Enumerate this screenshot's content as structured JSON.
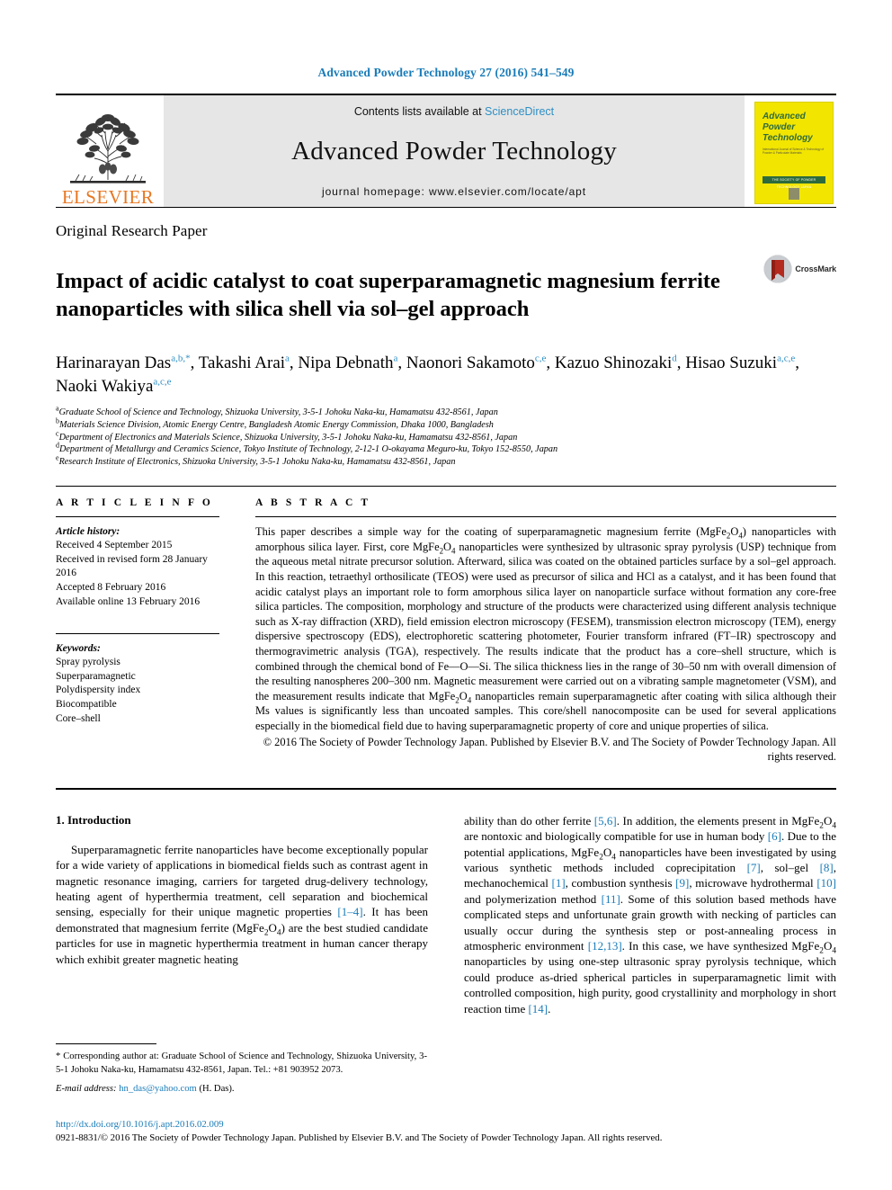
{
  "running_head": "Advanced Powder Technology 27 (2016) 541–549",
  "masthead": {
    "publisher": "ELSEVIER",
    "contents_prefix": "Contents lists available at ",
    "contents_link": "ScienceDirect",
    "journal_name": "Advanced Powder Technology",
    "homepage": "journal homepage: www.elsevier.com/locate/apt",
    "cover": {
      "line1": "Advanced",
      "line2": "Powder",
      "line3": "Technology",
      "subtitle": "International Journal of Science & Technology of Powder & Particulate Materials",
      "band": "THE SOCIETY OF POWDER TECHNOLOGY JAPAN"
    }
  },
  "article": {
    "paper_type": "Original Research Paper",
    "title": "Impact of acidic catalyst to coat superparamagnetic magnesium ferrite nanoparticles with silica shell via sol–gel approach",
    "crossmark_label": "CrossMark",
    "authors": [
      {
        "name": "Harinarayan Das",
        "marks": "a,b,*",
        "sep": ", "
      },
      {
        "name": "Takashi Arai",
        "marks": "a",
        "sep": ", "
      },
      {
        "name": "Nipa Debnath",
        "marks": "a",
        "sep": ", "
      },
      {
        "name": "Naonori Sakamoto",
        "marks": "c,e",
        "sep": ", "
      },
      {
        "name": "Kazuo Shinozaki",
        "marks": "d",
        "sep": ", "
      },
      {
        "name": "Hisao Suzuki",
        "marks": "a,c,e",
        "sep": ", "
      },
      {
        "name": "Naoki Wakiya",
        "marks": "a,c,e",
        "sep": ""
      }
    ],
    "affiliations": [
      {
        "mark": "a",
        "text": "Graduate School of Science and Technology, Shizuoka University, 3-5-1 Johoku Naka-ku, Hamamatsu 432-8561, Japan"
      },
      {
        "mark": "b",
        "text": "Materials Science Division, Atomic Energy Centre, Bangladesh Atomic Energy Commission, Dhaka 1000, Bangladesh"
      },
      {
        "mark": "c",
        "text": "Department of Electronics and Materials Science, Shizuoka University, 3-5-1 Johoku Naka-ku, Hamamatsu 432-8561, Japan"
      },
      {
        "mark": "d",
        "text": "Department of Metallurgy and Ceramics Science, Tokyo Institute of Technology, 2-12-1 O-okayama Meguro-ku, Tokyo 152-8550, Japan"
      },
      {
        "mark": "e",
        "text": "Research Institute of Electronics, Shizuoka University, 3-5-1 Johoku Naka-ku, Hamamatsu 432-8561, Japan"
      }
    ]
  },
  "article_info": {
    "heading": "A R T I C L E    I N F O",
    "history_label": "Article history:",
    "history": [
      "Received 4 September 2015",
      "Received in revised form 28 January 2016",
      "Accepted 8 February 2016",
      "Available online 13 February 2016"
    ],
    "keywords_label": "Keywords:",
    "keywords": [
      "Spray pyrolysis",
      "Superparamagnetic",
      "Polydispersity index",
      "Biocompatible",
      "Core–shell"
    ]
  },
  "abstract": {
    "heading": "A B S T R A C T",
    "body_html": "This paper describes a simple way for the coating of superparamagnetic magnesium ferrite (MgFe<sub>2</sub>O<sub>4</sub>) nanoparticles with amorphous silica layer. First, core MgFe<sub>2</sub>O<sub>4</sub> nanoparticles were synthesized by ultrasonic spray pyrolysis (USP) technique from the aqueous metal nitrate precursor solution. Afterward, silica was coated on the obtained particles surface by a sol–gel approach. In this reaction, tetraethyl orthosilicate (TEOS) were used as precursor of silica and HCl as a catalyst, and it has been found that acidic catalyst plays an important role to form amorphous silica layer on nanoparticle surface without formation any core-free silica particles. The composition, morphology and structure of the products were characterized using different analysis technique such as X-ray diffraction (XRD), field emission electron microscopy (FESEM), transmission electron microscopy (TEM), energy dispersive spectroscopy (EDS), electrophoretic scattering photometer, Fourier transform infrared (FT–IR) spectroscopy and thermogravimetric analysis (TGA), respectively. The results indicate that the product has a core–shell structure, which is combined through the chemical bond of Fe—O—Si. The silica thickness lies in the range of 30–50 nm with overall dimension of the resulting nanospheres 200–300 nm. Magnetic measurement were carried out on a vibrating sample magnetometer (VSM), and the measurement results indicate that MgFe<sub>2</sub>O<sub>4</sub> nanoparticles remain superparamagnetic after coating with silica although their Ms values is significantly less than uncoated samples. This core/shell nanocomposite can be used for several applications especially in the biomedical field due to having superparamagnetic property of core and unique properties of silica.",
    "copyright": "© 2016 The Society of Powder Technology Japan. Published by Elsevier B.V. and The Society of Powder Technology Japan. All rights reserved."
  },
  "introduction": {
    "heading": "1. Introduction",
    "left_html": "Superparamagnetic ferrite nanoparticles have become exceptionally popular for a wide variety of applications in biomedical fields such as contrast agent in magnetic resonance imaging, carriers for targeted drug-delivery technology, heating agent of hyperthermia treatment, cell separation and biochemical sensing, especially for their unique magnetic properties <span class=\"ref\">[1–4]</span>. It has been demonstrated that magnesium ferrite (MgFe<sub>2</sub>O<sub>4</sub>) are the best studied candidate particles for use in magnetic hyperthermia treatment in human cancer therapy which exhibit greater magnetic heating",
    "right_html": "ability than do other ferrite <span class=\"ref\">[5,6]</span>. In addition, the elements present in MgFe<sub>2</sub>O<sub>4</sub> are nontoxic and biologically compatible for use in human body <span class=\"ref\">[6]</span>. Due to the potential applications, MgFe<sub>2</sub>O<sub>4</sub> nanoparticles have been investigated by using various synthetic methods included coprecipitation <span class=\"ref\">[7]</span>, sol–gel <span class=\"ref\">[8]</span>, mechanochemical <span class=\"ref\">[1]</span>, combustion synthesis <span class=\"ref\">[9]</span>, microwave hydrothermal <span class=\"ref\">[10]</span> and polymerization method <span class=\"ref\">[11]</span>. Some of this solution based methods have complicated steps and unfortunate grain growth with necking of particles can usually occur during the synthesis step or post-annealing process in atmospheric environment <span class=\"ref\">[12,13]</span>. In this case, we have synthesized MgFe<sub>2</sub>O<sub>4</sub> nanoparticles by using one-step ultrasonic spray pyrolysis technique, which could produce as-dried spherical particles in superparamagnetic limit with controlled composition, high purity, good crystallinity and morphology in short reaction time <span class=\"ref\">[14]</span>."
  },
  "footnotes": {
    "corresponding": "* Corresponding author at: Graduate School of Science and Technology, Shizuoka University, 3-5-1 Johoku Naka-ku, Hamamatsu 432-8561, Japan. Tel.: +81 903952 2073.",
    "email_label": "E-mail address:",
    "email": "hn_das@yahoo.com",
    "email_owner": "(H. Das)."
  },
  "page_footer": {
    "doi": "http://dx.doi.org/10.1016/j.apt.2016.02.009",
    "copyright": "0921-8831/© 2016 The Society of Powder Technology Japan. Published by Elsevier B.V. and The Society of Powder Technology Japan. All rights reserved."
  },
  "colors": {
    "link_blue": "#1a7cb8",
    "elsevier_orange": "#e87722",
    "cover_yellow": "#f2e500",
    "masthead_grey": "#e6e6e6"
  }
}
